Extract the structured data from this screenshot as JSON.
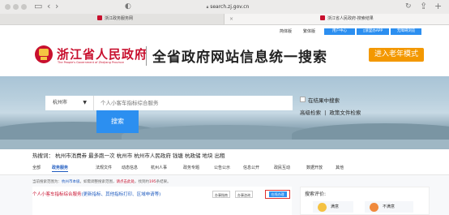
{
  "browser": {
    "url": "search.zj.gov.cn",
    "tabs": [
      {
        "title": "浙江政务服务网"
      },
      {
        "title": "浙江省人民政府-搜索结果"
      }
    ]
  },
  "topbar": {
    "simplified": "简体版",
    "traditional": "繁体版",
    "user_center": "用户中心",
    "zwfw_app": "浙里办APP",
    "accessibility": "无障碍浏览"
  },
  "header": {
    "gov_name": "浙江省人民政府",
    "gov_name_en": "The People's Government of Zhejiang Province",
    "site_title": "全省政府网站信息统一搜索",
    "elder_mode": "进入老年模式"
  },
  "search": {
    "scope": "杭州市",
    "placeholder": "个人小客车指标综合服务",
    "button": "搜索",
    "in_results": "在结果中搜索",
    "advanced": "高级检索",
    "policy_search": "政策文件检索",
    "separator": "|"
  },
  "hot": {
    "label": "热搜词：",
    "words": [
      "杭州市消费券",
      "最多跑一次",
      "杭州市",
      "杭州市人民政府",
      "钱塘",
      "杭政储",
      "地块",
      "出租"
    ]
  },
  "tabs": [
    {
      "label": "全部",
      "active": false
    },
    {
      "label": "政务服务",
      "active": true
    },
    {
      "label": "法规文件",
      "active": false
    },
    {
      "label": "动态信息",
      "active": false
    },
    {
      "label": "杭州人事",
      "active": false
    },
    {
      "label": "政务专题",
      "active": false
    },
    {
      "label": "公告公示",
      "active": false
    },
    {
      "label": "信息公开",
      "active": false
    },
    {
      "label": "政民互动",
      "active": false
    },
    {
      "label": "数据开放",
      "active": false
    },
    {
      "label": "其他",
      "active": false
    }
  ],
  "results": {
    "summary_prefix": "当前搜索范围为：",
    "summary_scope": "杭州市本级",
    "summary_mid": "。如需调整搜索范围，",
    "summary_link": "请点击此处",
    "summary_tail": "。找到约",
    "summary_count": "195",
    "summary_end": "条结果。",
    "first_title": "个人小客车指标综合服务",
    "first_title_links": "(更新指标、其他指标打印、区域申请等)",
    "btn_guide": "办事指南",
    "btn_online": "办事咨询",
    "btn_apply": "在线办理"
  },
  "feedback": {
    "title": "搜索评价:",
    "satisfied": "满意",
    "unsatisfied": "不满意"
  },
  "colors": {
    "accent_red": "#c8102e",
    "accent_blue": "#2c8ff0",
    "elder_orange": "#f39800",
    "link_blue": "#1f5bbf"
  }
}
